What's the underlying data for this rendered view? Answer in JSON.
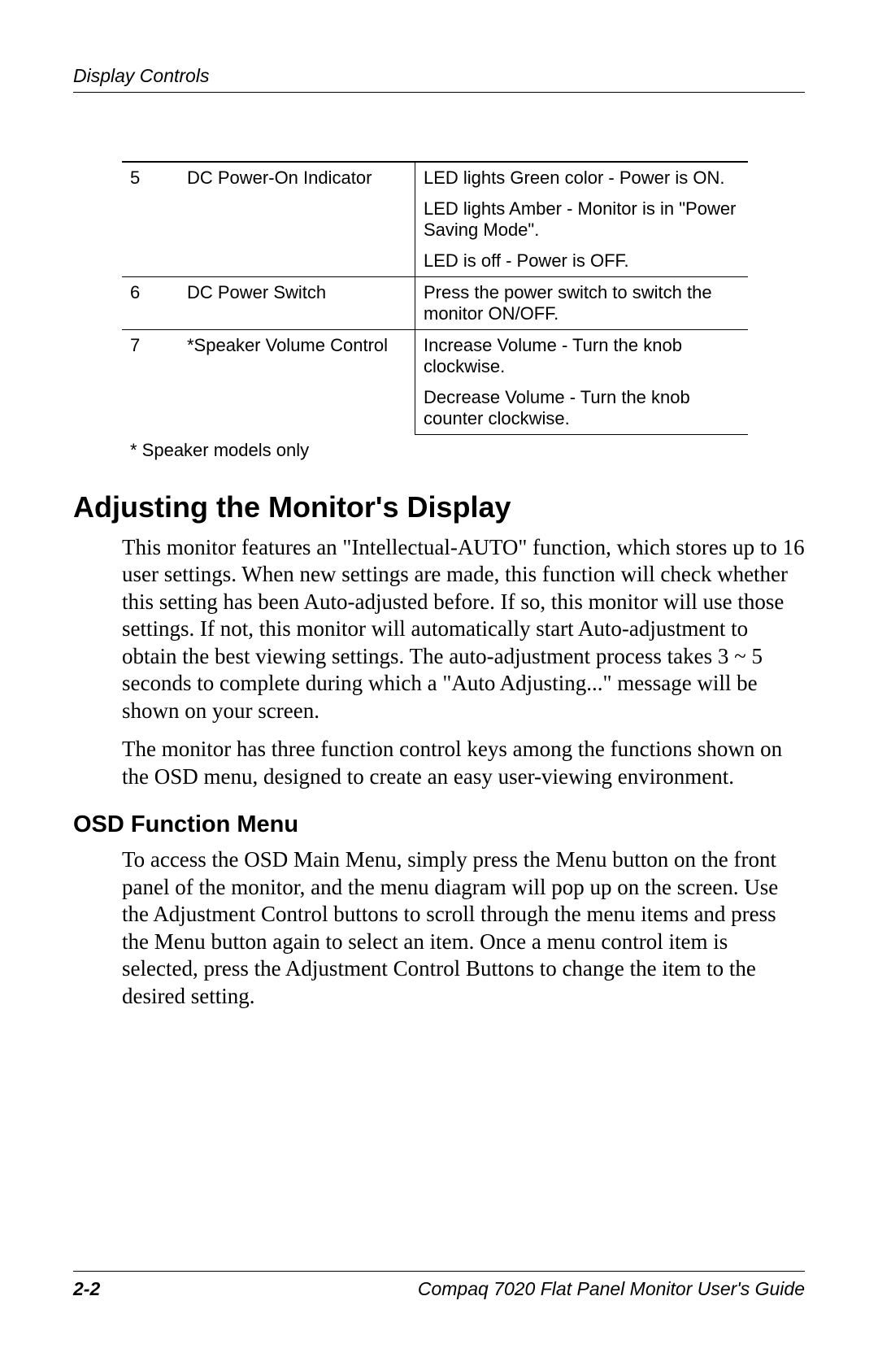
{
  "header": "Display Controls",
  "table": {
    "rows": [
      {
        "num": "5",
        "name": "DC Power-On Indicator",
        "lines": [
          "LED lights Green color - Power is ON.",
          "LED lights Amber - Monitor is in \"Power Saving Mode\".",
          "LED is off - Power is OFF."
        ]
      },
      {
        "num": "6",
        "name": "DC Power Switch",
        "lines": [
          "Press the power switch to switch the monitor ON/OFF."
        ]
      },
      {
        "num": "7",
        "name": "*Speaker Volume Control",
        "lines": [
          "Increase Volume - Turn the knob clockwise.",
          "Decrease Volume - Turn the knob counter clockwise."
        ]
      }
    ],
    "footnote": "* Speaker models only"
  },
  "section1": {
    "title": "Adjusting the Monitor's Display",
    "p1": "This monitor features an \"Intellectual-AUTO\" function, which stores up to 16 user settings. When new settings are made, this function will check whether this setting has been Auto-adjusted before. If so, this monitor will use those settings. If not, this monitor will automatically start Auto-adjustment to obtain the best viewing settings. The auto-adjustment process takes 3 ~ 5 seconds to complete during which a \"Auto Adjusting...\" message will be shown on your screen.",
    "p2": "The monitor has three function control keys among the functions shown on the OSD menu, designed to create an easy user-viewing environment."
  },
  "section2": {
    "title": "OSD Function Menu",
    "p1": "To access the OSD Main Menu, simply press the Menu button on the front panel of the monitor, and the menu diagram will pop up on the screen. Use the Adjustment Control buttons to scroll through the menu items and press the Menu button again to select an item. Once a menu control item is selected, press the Adjustment Control Buttons to change the item to the desired setting."
  },
  "footer": {
    "page": "2-2",
    "title": "Compaq 7020 Flat Panel Monitor User's Guide"
  }
}
